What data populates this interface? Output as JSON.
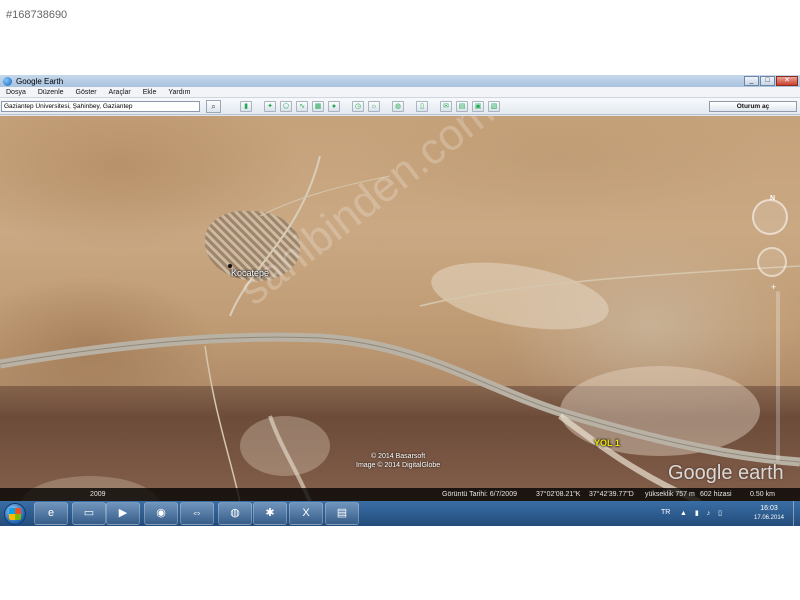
{
  "listing_id": "#168738690",
  "app": {
    "title": "Google Earth",
    "window_controls": [
      "_",
      "□",
      "✕"
    ]
  },
  "menu": [
    "Dosya",
    "Düzenle",
    "Göster",
    "Araçlar",
    "Ekle",
    "Yardım"
  ],
  "search": {
    "value": "Gaziantep Üniversitesi, Şahinbey, Gaziantep"
  },
  "toolbar": {
    "signin_label": "Oturum aç"
  },
  "map": {
    "place_label": "Kocatepe",
    "road_label": "YOL 1",
    "watermark": "sahibinden.com",
    "copyright_line1": "© 2014 Basarsoft",
    "copyright_line2": "Image © 2014 DigitalGlobe",
    "logo": "Google earth",
    "compass_north": "N"
  },
  "status": {
    "year": "2009",
    "imagery_date": "Görüntü Tarihi: 6/7/2009",
    "lat": "37°02'08.21\"K",
    "lon": "37°42'39.77\"D",
    "elevation": "yükseklik 757 m",
    "eye_alt": "602 hizasi",
    "eye_alt_km": "0.50 km"
  },
  "taskbar": {
    "language": "TR",
    "time": "16:03",
    "date": "17.06.2014"
  },
  "colors": {
    "road_label": "#f2e600",
    "taskbar": "#2f5e93"
  }
}
